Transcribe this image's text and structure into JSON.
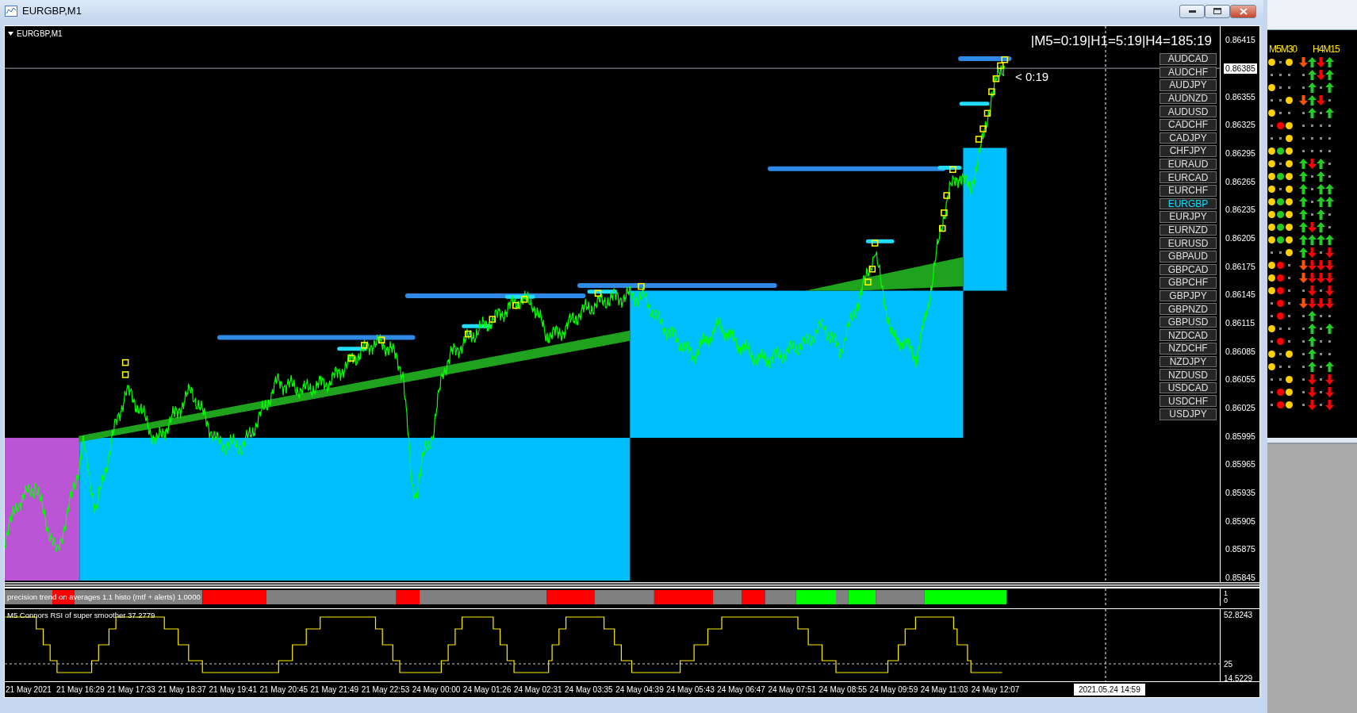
{
  "window": {
    "title": "EURGBP,M1"
  },
  "chart": {
    "label": "EURGBP,M1",
    "timer": "|M5=0:19|H1=5:19|H4=185:19",
    "candle_timer": "< 0:19",
    "symbols": [
      {
        "label": "AUDCAD",
        "selected": false
      },
      {
        "label": "AUDCHF",
        "selected": false
      },
      {
        "label": "AUDJPY",
        "selected": false
      },
      {
        "label": "AUDNZD",
        "selected": false
      },
      {
        "label": "AUDUSD",
        "selected": false
      },
      {
        "label": "CADCHF",
        "selected": false
      },
      {
        "label": "CADJPY",
        "selected": false
      },
      {
        "label": "CHFJPY",
        "selected": false
      },
      {
        "label": "EURAUD",
        "selected": false
      },
      {
        "label": "EURCAD",
        "selected": false
      },
      {
        "label": "EURCHF",
        "selected": false
      },
      {
        "label": "EURGBP",
        "selected": true
      },
      {
        "label": "EURJPY",
        "selected": false
      },
      {
        "label": "EURNZD",
        "selected": false
      },
      {
        "label": "EURUSD",
        "selected": false
      },
      {
        "label": "GBPAUD",
        "selected": false
      },
      {
        "label": "GBPCAD",
        "selected": false
      },
      {
        "label": "GBPCHF",
        "selected": false
      },
      {
        "label": "GBPJPY",
        "selected": false
      },
      {
        "label": "GBPNZD",
        "selected": false
      },
      {
        "label": "GBPUSD",
        "selected": false
      },
      {
        "label": "NZDCAD",
        "selected": false
      },
      {
        "label": "NZDCHF",
        "selected": false
      },
      {
        "label": "NZDJPY",
        "selected": false
      },
      {
        "label": "NZDUSD",
        "selected": false
      },
      {
        "label": "USDCAD",
        "selected": false
      },
      {
        "label": "USDCHF",
        "selected": false
      },
      {
        "label": "USDJPY",
        "selected": false
      }
    ],
    "price_axis": [
      {
        "label": "0.86415",
        "current": false
      },
      {
        "label": "0.86385",
        "current": true
      },
      {
        "label": "0.86355",
        "current": false
      },
      {
        "label": "0.86325",
        "current": false
      },
      {
        "label": "0.86295",
        "current": false
      },
      {
        "label": "0.86265",
        "current": false
      },
      {
        "label": "0.86235",
        "current": false
      },
      {
        "label": "0.86205",
        "current": false
      },
      {
        "label": "0.86175",
        "current": false
      },
      {
        "label": "0.86145",
        "current": false
      },
      {
        "label": "0.86115",
        "current": false
      },
      {
        "label": "0.86085",
        "current": false
      },
      {
        "label": "0.86055",
        "current": false
      },
      {
        "label": "0.86025",
        "current": false
      },
      {
        "label": "0.85995",
        "current": false
      },
      {
        "label": "0.85965",
        "current": false
      },
      {
        "label": "0.85935",
        "current": false
      },
      {
        "label": "0.85905",
        "current": false
      },
      {
        "label": "0.85875",
        "current": false
      },
      {
        "label": "0.85845",
        "current": false
      }
    ]
  },
  "histogram": {
    "label": "precision trend on averages 1.1 histo (mtf + alerts) 1.0000",
    "axis": [
      "1",
      "0"
    ]
  },
  "rsi": {
    "label": "M5 Connors RSI of super smoother 37.2779",
    "axis": [
      "52.8243",
      "25",
      "14.5229"
    ]
  },
  "time_axis": {
    "labels": [
      "21 May 2021",
      "21 May 16:29",
      "21 May 17:33",
      "21 May 18:37",
      "21 May 19:41",
      "21 May 20:45",
      "21 May 21:49",
      "21 May 22:53",
      "24 May 00:00",
      "24 May 01:26",
      "24 May 02:31",
      "24 May 03:35",
      "24 May 04:39",
      "24 May 05:43",
      "24 May 06:47",
      "24 May 07:51",
      "24 May 08:55",
      "24 May 09:59",
      "24 May 11:03",
      "24 May 12:07"
    ],
    "cursor": "2021.05.24 14:59"
  },
  "signals": {
    "headers": [
      "M5M30",
      "H4M15"
    ],
    "rows": [
      {
        "dots": [
          {
            "kind": "dot",
            "color": "#ffd200"
          },
          {
            "kind": "empty"
          },
          {
            "kind": "dot",
            "color": "#ffd200"
          }
        ],
        "arrows": [
          {
            "kind": "warn-down"
          },
          {
            "kind": "up"
          },
          {
            "kind": "down"
          },
          {
            "kind": "up"
          }
        ]
      },
      {
        "dots": [
          {
            "kind": "empty"
          },
          {
            "kind": "empty"
          },
          {
            "kind": "empty"
          }
        ],
        "arrows": [
          {
            "kind": "none"
          },
          {
            "kind": "up"
          },
          {
            "kind": "down"
          },
          {
            "kind": "up"
          }
        ]
      },
      {
        "dots": [
          {
            "kind": "dot",
            "color": "#ffd200"
          },
          {
            "kind": "empty"
          },
          {
            "kind": "empty"
          }
        ],
        "arrows": [
          {
            "kind": "none"
          },
          {
            "kind": "up"
          },
          {
            "kind": "none"
          },
          {
            "kind": "up"
          }
        ]
      },
      {
        "dots": [
          {
            "kind": "empty"
          },
          {
            "kind": "empty"
          },
          {
            "kind": "dot",
            "color": "#ffd200"
          }
        ],
        "arrows": [
          {
            "kind": "warn-down"
          },
          {
            "kind": "up"
          },
          {
            "kind": "down"
          },
          {
            "kind": "none"
          }
        ]
      },
      {
        "dots": [
          {
            "kind": "dot",
            "color": "#ffd200"
          },
          {
            "kind": "empty"
          },
          {
            "kind": "empty"
          }
        ],
        "arrows": [
          {
            "kind": "none"
          },
          {
            "kind": "up"
          },
          {
            "kind": "none"
          },
          {
            "kind": "up"
          }
        ]
      },
      {
        "dots": [
          {
            "kind": "empty"
          },
          {
            "kind": "dot",
            "color": "#ff0000"
          },
          {
            "kind": "dot",
            "color": "#ffd200"
          }
        ],
        "arrows": [
          {
            "kind": "none"
          },
          {
            "kind": "none"
          },
          {
            "kind": "none"
          },
          {
            "kind": "none"
          }
        ]
      },
      {
        "dots": [
          {
            "kind": "empty"
          },
          {
            "kind": "empty"
          },
          {
            "kind": "dot",
            "color": "#ffd200"
          }
        ],
        "arrows": [
          {
            "kind": "none"
          },
          {
            "kind": "none"
          },
          {
            "kind": "none"
          },
          {
            "kind": "none"
          }
        ]
      },
      {
        "dots": [
          {
            "kind": "dot",
            "color": "#ffd200"
          },
          {
            "kind": "dot",
            "color": "#22cc22"
          },
          {
            "kind": "dot",
            "color": "#ffd200"
          }
        ],
        "arrows": [
          {
            "kind": "none"
          },
          {
            "kind": "none"
          },
          {
            "kind": "none"
          },
          {
            "kind": "none"
          }
        ]
      },
      {
        "dots": [
          {
            "kind": "dot",
            "color": "#ffd200"
          },
          {
            "kind": "empty"
          },
          {
            "kind": "dot",
            "color": "#ffd200"
          }
        ],
        "arrows": [
          {
            "kind": "up"
          },
          {
            "kind": "down"
          },
          {
            "kind": "up"
          },
          {
            "kind": "none"
          }
        ]
      },
      {
        "dots": [
          {
            "kind": "dot",
            "color": "#ffd200"
          },
          {
            "kind": "dot",
            "color": "#22cc22"
          },
          {
            "kind": "dot",
            "color": "#ffd200"
          }
        ],
        "arrows": [
          {
            "kind": "up"
          },
          {
            "kind": "none"
          },
          {
            "kind": "up"
          },
          {
            "kind": "none"
          }
        ]
      },
      {
        "dots": [
          {
            "kind": "dot",
            "color": "#ffd200"
          },
          {
            "kind": "empty"
          },
          {
            "kind": "dot",
            "color": "#ffd200"
          }
        ],
        "arrows": [
          {
            "kind": "up"
          },
          {
            "kind": "none"
          },
          {
            "kind": "up"
          },
          {
            "kind": "up"
          }
        ]
      },
      {
        "dots": [
          {
            "kind": "dot",
            "color": "#ffd200"
          },
          {
            "kind": "dot",
            "color": "#22cc22"
          },
          {
            "kind": "dot",
            "color": "#ffd200"
          }
        ],
        "arrows": [
          {
            "kind": "up"
          },
          {
            "kind": "none"
          },
          {
            "kind": "up"
          },
          {
            "kind": "up"
          }
        ]
      },
      {
        "dots": [
          {
            "kind": "dot",
            "color": "#ffd200"
          },
          {
            "kind": "dot",
            "color": "#22cc22"
          },
          {
            "kind": "dot",
            "color": "#ffd200"
          }
        ],
        "arrows": [
          {
            "kind": "up"
          },
          {
            "kind": "none"
          },
          {
            "kind": "up"
          },
          {
            "kind": "none"
          }
        ]
      },
      {
        "dots": [
          {
            "kind": "dot",
            "color": "#ffd200"
          },
          {
            "kind": "dot",
            "color": "#22cc22"
          },
          {
            "kind": "dot",
            "color": "#ffd200"
          }
        ],
        "arrows": [
          {
            "kind": "up"
          },
          {
            "kind": "down"
          },
          {
            "kind": "up"
          },
          {
            "kind": "none"
          }
        ]
      },
      {
        "dots": [
          {
            "kind": "dot",
            "color": "#ffd200"
          },
          {
            "kind": "dot",
            "color": "#22cc22"
          },
          {
            "kind": "dot",
            "color": "#ffd200"
          }
        ],
        "arrows": [
          {
            "kind": "up"
          },
          {
            "kind": "up"
          },
          {
            "kind": "up"
          },
          {
            "kind": "up"
          }
        ]
      },
      {
        "dots": [
          {
            "kind": "empty"
          },
          {
            "kind": "empty"
          },
          {
            "kind": "dot",
            "color": "#ffd200"
          }
        ],
        "arrows": [
          {
            "kind": "up"
          },
          {
            "kind": "down"
          },
          {
            "kind": "none"
          },
          {
            "kind": "down"
          }
        ]
      },
      {
        "dots": [
          {
            "kind": "dot",
            "color": "#ffd200"
          },
          {
            "kind": "dot",
            "color": "#ff0000"
          },
          {
            "kind": "empty"
          }
        ],
        "arrows": [
          {
            "kind": "warn-down"
          },
          {
            "kind": "down"
          },
          {
            "kind": "down"
          },
          {
            "kind": "down"
          }
        ]
      },
      {
        "dots": [
          {
            "kind": "dot",
            "color": "#ffd200"
          },
          {
            "kind": "dot",
            "color": "#ff0000"
          },
          {
            "kind": "empty"
          }
        ],
        "arrows": [
          {
            "kind": "warn-down"
          },
          {
            "kind": "down"
          },
          {
            "kind": "down"
          },
          {
            "kind": "down"
          }
        ]
      },
      {
        "dots": [
          {
            "kind": "dot",
            "color": "#ffd200"
          },
          {
            "kind": "dot",
            "color": "#ff0000"
          },
          {
            "kind": "empty"
          }
        ],
        "arrows": [
          {
            "kind": "none"
          },
          {
            "kind": "down"
          },
          {
            "kind": "none"
          },
          {
            "kind": "down"
          }
        ]
      },
      {
        "dots": [
          {
            "kind": "empty"
          },
          {
            "kind": "dot",
            "color": "#ff0000"
          },
          {
            "kind": "empty"
          }
        ],
        "arrows": [
          {
            "kind": "warn-down"
          },
          {
            "kind": "down"
          },
          {
            "kind": "down"
          },
          {
            "kind": "down"
          }
        ]
      },
      {
        "dots": [
          {
            "kind": "empty"
          },
          {
            "kind": "dot",
            "color": "#ff0000"
          },
          {
            "kind": "empty"
          }
        ],
        "arrows": [
          {
            "kind": "none"
          },
          {
            "kind": "up"
          },
          {
            "kind": "none"
          },
          {
            "kind": "none"
          }
        ]
      },
      {
        "dots": [
          {
            "kind": "dot",
            "color": "#ffd200"
          },
          {
            "kind": "empty"
          },
          {
            "kind": "empty"
          }
        ],
        "arrows": [
          {
            "kind": "none"
          },
          {
            "kind": "up"
          },
          {
            "kind": "none"
          },
          {
            "kind": "up"
          }
        ]
      },
      {
        "dots": [
          {
            "kind": "empty"
          },
          {
            "kind": "dot",
            "color": "#ff0000"
          },
          {
            "kind": "empty"
          }
        ],
        "arrows": [
          {
            "kind": "none"
          },
          {
            "kind": "up"
          },
          {
            "kind": "none"
          },
          {
            "kind": "none"
          }
        ]
      },
      {
        "dots": [
          {
            "kind": "dot",
            "color": "#ffd200"
          },
          {
            "kind": "empty"
          },
          {
            "kind": "dot",
            "color": "#ffd200"
          }
        ],
        "arrows": [
          {
            "kind": "none"
          },
          {
            "kind": "up"
          },
          {
            "kind": "none"
          },
          {
            "kind": "none"
          }
        ]
      },
      {
        "dots": [
          {
            "kind": "dot",
            "color": "#ffd200"
          },
          {
            "kind": "empty"
          },
          {
            "kind": "empty"
          }
        ],
        "arrows": [
          {
            "kind": "none"
          },
          {
            "kind": "up"
          },
          {
            "kind": "none"
          },
          {
            "kind": "up"
          }
        ]
      },
      {
        "dots": [
          {
            "kind": "empty"
          },
          {
            "kind": "empty"
          },
          {
            "kind": "dot",
            "color": "#ffd200"
          }
        ],
        "arrows": [
          {
            "kind": "none"
          },
          {
            "kind": "down"
          },
          {
            "kind": "none"
          },
          {
            "kind": "down"
          }
        ]
      },
      {
        "dots": [
          {
            "kind": "empty"
          },
          {
            "kind": "dot",
            "color": "#ff0000"
          },
          {
            "kind": "dot",
            "color": "#ffd200"
          }
        ],
        "arrows": [
          {
            "kind": "none"
          },
          {
            "kind": "down"
          },
          {
            "kind": "none"
          },
          {
            "kind": "down"
          }
        ]
      },
      {
        "dots": [
          {
            "kind": "empty"
          },
          {
            "kind": "dot",
            "color": "#ff0000"
          },
          {
            "kind": "dot",
            "color": "#ffd200"
          }
        ],
        "arrows": [
          {
            "kind": "none"
          },
          {
            "kind": "down"
          },
          {
            "kind": "none"
          },
          {
            "kind": "down"
          }
        ]
      }
    ]
  }
}
